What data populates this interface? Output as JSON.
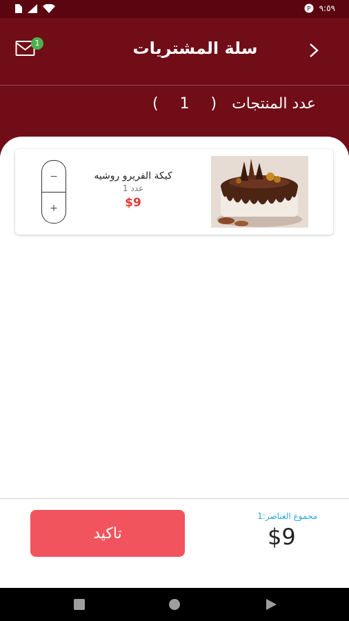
{
  "status_bar": {
    "time": "٩:٥٩",
    "icons": [
      "sim-icon",
      "signal-icon",
      "wifi-icon",
      "notification-icon"
    ]
  },
  "header": {
    "title": "سلة المشتريات",
    "cart_badge_count": "1",
    "product_count_label": "عدد المنتجات",
    "product_count_value": "( 1 )"
  },
  "cart_items": [
    {
      "name": "كيكة الفريرو روشيه",
      "quantity_label": "عدد 1",
      "price": "$9",
      "image": "chocolate-cake-image"
    }
  ],
  "stepper": {
    "decrement": "−",
    "increment": "+"
  },
  "footer": {
    "confirm_label": "تاكيد",
    "total_items_label": "مجموع العناصر:1",
    "total_value": "$9"
  },
  "colors": {
    "header_bg": "#700d17",
    "status_bar_bg": "#5a0510",
    "confirm_button": "#f1545c",
    "price_red": "#e53935",
    "total_label_blue": "#29a8d8",
    "badge_green": "#4caf50"
  },
  "nav_bar": {
    "icons": [
      "recent-apps-icon",
      "home-icon",
      "back-nav-icon"
    ]
  }
}
